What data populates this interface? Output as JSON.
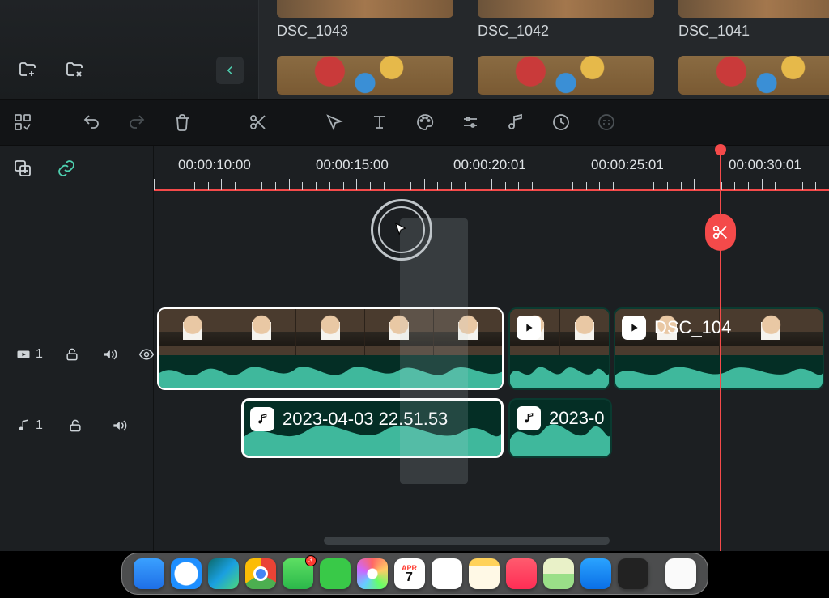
{
  "media": {
    "items": [
      {
        "label": "DSC_1043"
      },
      {
        "label": "DSC_1042"
      },
      {
        "label": "DSC_1041"
      }
    ]
  },
  "ruler": {
    "labels": [
      "00:00:10:00",
      "00:00:15:00",
      "00:00:20:01",
      "00:00:25:01",
      "00:00:30:01"
    ]
  },
  "tracks": {
    "video": {
      "label": "1"
    },
    "audio": {
      "label": "1"
    }
  },
  "clips": {
    "video3_label": "DSC_104",
    "audio1_label": "2023-04-03 22.51.53",
    "audio2_label": "2023-0"
  },
  "dock": {
    "cal_day": "APR",
    "cal_num": "7",
    "msg_badge": "3"
  }
}
